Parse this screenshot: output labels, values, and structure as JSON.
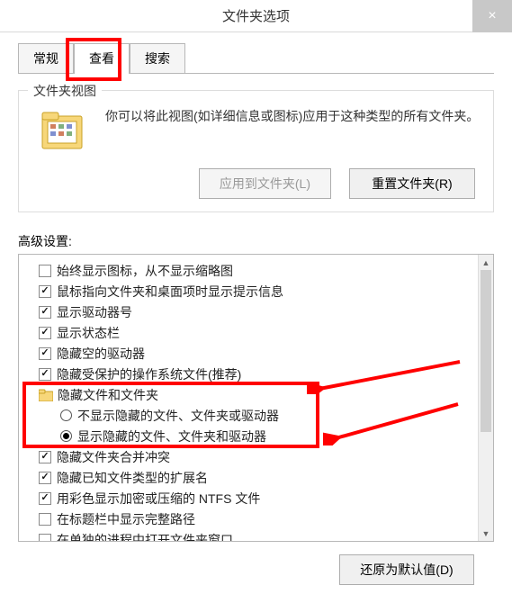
{
  "titlebar": {
    "title": "文件夹选项",
    "close": "×"
  },
  "tabs": {
    "general": "常规",
    "view": "查看",
    "search": "搜索"
  },
  "folderview": {
    "legend": "文件夹视图",
    "desc": "你可以将此视图(如详细信息或图标)应用于这种类型的所有文件夹。",
    "apply": "应用到文件夹(L)",
    "reset": "重置文件夹(R)"
  },
  "adv": {
    "label": "高级设置:",
    "items": [
      {
        "type": "check",
        "checked": false,
        "label": "始终显示图标，从不显示缩略图"
      },
      {
        "type": "check",
        "checked": true,
        "label": "鼠标指向文件夹和桌面项时显示提示信息"
      },
      {
        "type": "check",
        "checked": true,
        "label": "显示驱动器号"
      },
      {
        "type": "check",
        "checked": true,
        "label": "显示状态栏"
      },
      {
        "type": "check",
        "checked": true,
        "label": "隐藏空的驱动器"
      },
      {
        "type": "check",
        "checked": true,
        "label": "隐藏受保护的操作系统文件(推荐)"
      },
      {
        "type": "folder",
        "label": "隐藏文件和文件夹"
      },
      {
        "type": "radio",
        "checked": false,
        "label": "不显示隐藏的文件、文件夹或驱动器"
      },
      {
        "type": "radio",
        "checked": true,
        "label": "显示隐藏的文件、文件夹和驱动器"
      },
      {
        "type": "check",
        "checked": true,
        "label": "隐藏文件夹合并冲突"
      },
      {
        "type": "check",
        "checked": true,
        "label": "隐藏已知文件类型的扩展名"
      },
      {
        "type": "check",
        "checked": true,
        "label": "用彩色显示加密或压缩的 NTFS 文件"
      },
      {
        "type": "check",
        "checked": false,
        "label": "在标题栏中显示完整路径"
      },
      {
        "type": "check",
        "checked": false,
        "label": "在单独的进程中打开文件夹窗口"
      }
    ]
  },
  "footer": {
    "restore": "还原为默认值(D)"
  }
}
